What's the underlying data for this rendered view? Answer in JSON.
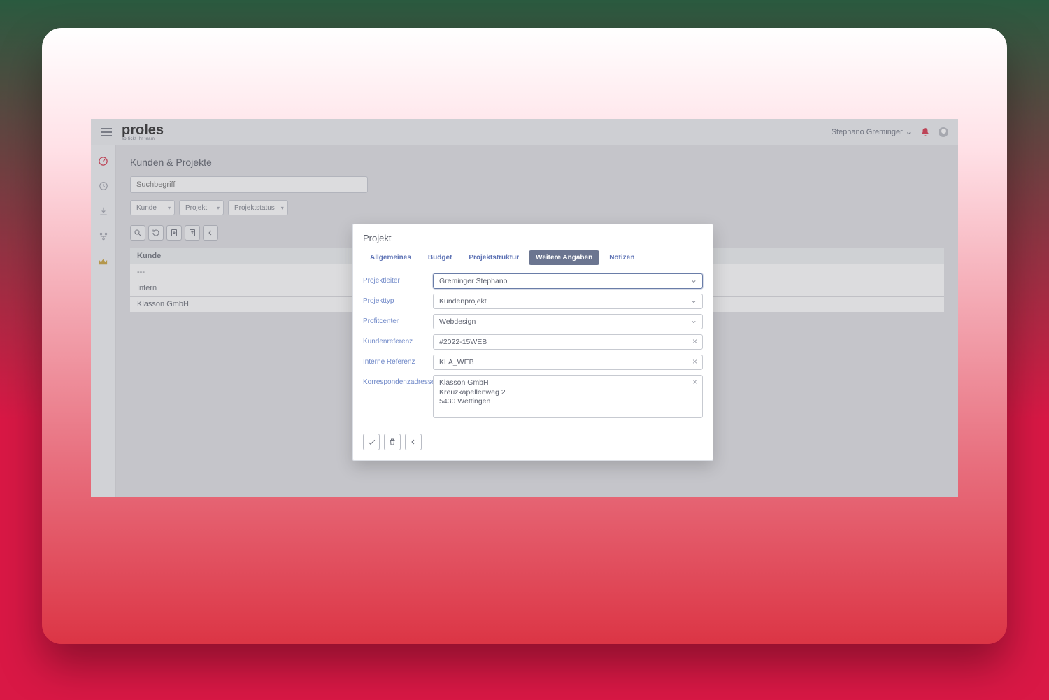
{
  "header": {
    "logo": "proles",
    "tagline": "so tickt ihr team",
    "user": "Stephano Greminger"
  },
  "sidebar": {
    "items": [
      "dashboard",
      "clock",
      "download",
      "nodes",
      "crown"
    ]
  },
  "page": {
    "title": "Kunden & Projekte",
    "search_placeholder": "Suchbegriff",
    "filters": {
      "kunde": "Kunde",
      "projekt": "Projekt",
      "status": "Projektstatus"
    }
  },
  "list": {
    "header": "Kunde",
    "rows": [
      "---",
      "Intern",
      "Klasson GmbH"
    ]
  },
  "modal": {
    "title": "Projekt",
    "tabs": [
      "Allgemeines",
      "Budget",
      "Projektstruktur",
      "Weitere Angaben",
      "Notizen"
    ],
    "active_tab": 3,
    "fields": {
      "projektleiter": {
        "label": "Projektleiter",
        "value": "Greminger Stephano"
      },
      "projekttyp": {
        "label": "Projekttyp",
        "value": "Kundenprojekt"
      },
      "profitcenter": {
        "label": "Profitcenter",
        "value": "Webdesign"
      },
      "kundenreferenz": {
        "label": "Kundenreferenz",
        "value": "#2022-15WEB"
      },
      "interneref": {
        "label": "Interne Referenz",
        "value": "KLA_WEB"
      },
      "adresse": {
        "label": "Korrespondenzadresse",
        "value": "Klasson GmbH\nKreuzkapellenweg 2\n5430 Wettingen"
      }
    }
  }
}
